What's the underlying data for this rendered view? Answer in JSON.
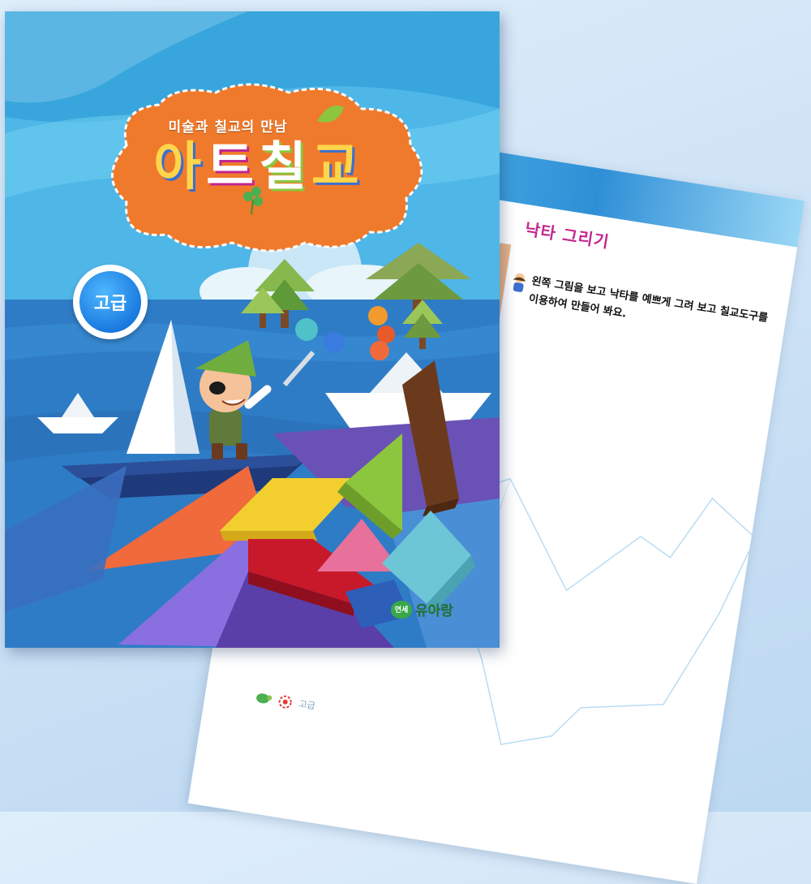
{
  "cover": {
    "subtitle": "미술과 칠교의 만남",
    "title": "아트칠교",
    "title_glyphs": [
      "아",
      "트",
      "칠",
      "교"
    ],
    "level": "고급",
    "publisher": {
      "mark": "연세",
      "name": "유아랑"
    }
  },
  "worksheet": {
    "title": "낙타 그리기",
    "instruction": "왼쪽 그림을 보고 낙타를 예쁘게 그려 보고 칠교도구를 이용하여 만들어 봐요.",
    "footer_level": "고급"
  },
  "colors": {
    "cover_orange": "#f07a2b",
    "sky_blue": "#4fb6e8",
    "sea_blue": "#2f7cc6",
    "title_magenta": "#c2278f",
    "tangram_yellow": "#f2cf2e",
    "tangram_red": "#c8192b",
    "tangram_pink": "#e7719a",
    "tangram_green": "#8cc63e",
    "tangram_brown": "#6b3a1c",
    "tangram_cyan": "#6cc6d6",
    "tangram_orange": "#f06a3c",
    "tangram_purple": "#7a5cc0"
  },
  "icons": [
    "clover-icon",
    "leaf-icon",
    "pirate-boy-icon",
    "paper-boat-icon",
    "tree-icon",
    "balloon-icon",
    "turtle-icon",
    "crab-icon"
  ]
}
